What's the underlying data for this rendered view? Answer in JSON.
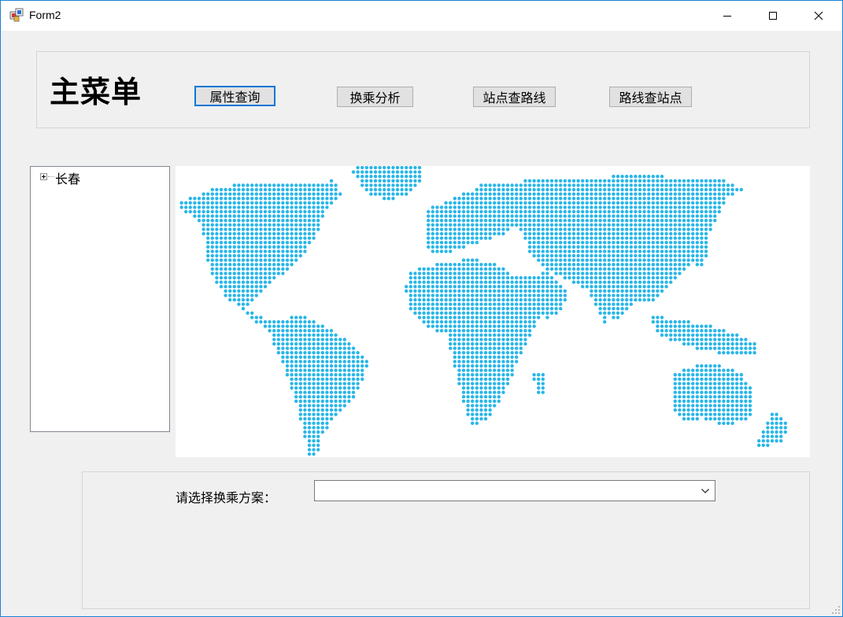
{
  "window": {
    "title": "Form2",
    "accent_color": "#1883d7"
  },
  "icons": {
    "app": "form-app-icon",
    "minimize": "minimize-icon",
    "maximize": "maximize-icon",
    "close": "close-icon",
    "dropdown": "chevron-down-icon",
    "expander": "tree-plus-icon",
    "grip": "resize-grip-icon"
  },
  "menu": {
    "title": "主菜单",
    "buttons": {
      "attribute_query": "属性查询",
      "transfer_analysis": "换乘分析",
      "station_to_route": "站点查路线",
      "route_to_station": "路线查站点"
    },
    "focused": "属性查询"
  },
  "tree": {
    "root": {
      "label": "长春",
      "expanded": false
    }
  },
  "map": {
    "image": "dotted-world-map",
    "dot_color": "#29b6e8"
  },
  "transfer": {
    "label": "请选择换乘方案：",
    "selected": ""
  }
}
